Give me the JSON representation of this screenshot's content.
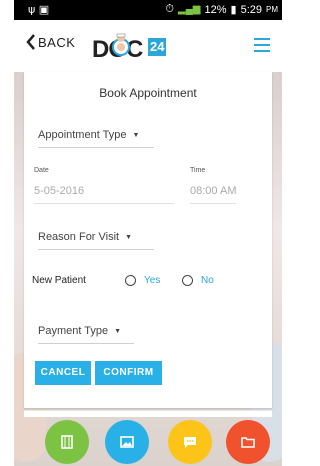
{
  "status_bar": {
    "left_icons": "ψ ▣",
    "battery_percent": "12%",
    "time": "5:29",
    "ampm": "PM"
  },
  "header": {
    "back_label": "BACK",
    "logo_text": "DOC",
    "logo_number": "24",
    "accent_color": "#29a8e0"
  },
  "form": {
    "title": "Book Appointment",
    "appointment_type": "Appointment Type",
    "date_label": "Date",
    "date_value": "5-05-2016",
    "time_label": "Time",
    "time_value": "08:00 AM",
    "reason": "Reason For Visit",
    "new_patient_label": "New Patient",
    "yes_label": "Yes",
    "no_label": "No",
    "payment_type": "Payment Type",
    "cancel_label": "CANCEL",
    "confirm_label": "CONFIRM"
  },
  "fab_buttons": [
    {
      "icon": "film-icon",
      "color": "#7cc243"
    },
    {
      "icon": "image-icon",
      "color": "#29b0e6"
    },
    {
      "icon": "chat-icon",
      "color": "#fcc419"
    },
    {
      "icon": "folder-icon",
      "color": "#f0522d"
    }
  ]
}
